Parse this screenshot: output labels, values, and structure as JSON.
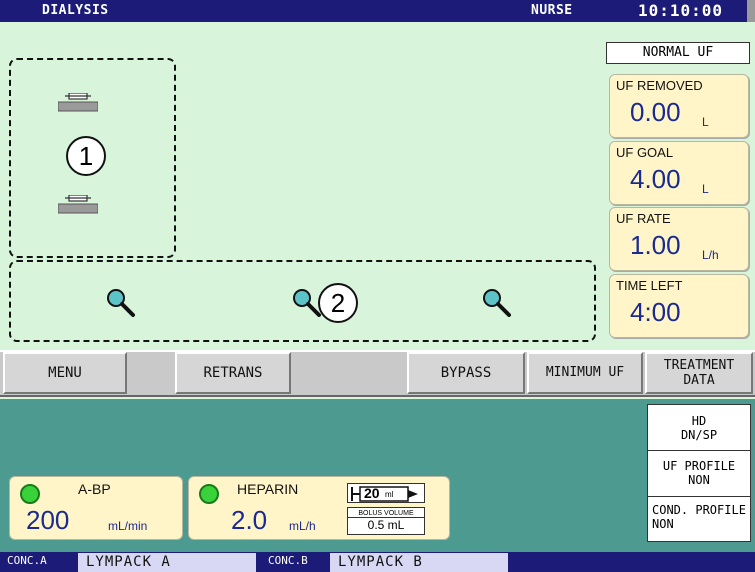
{
  "header": {
    "mode": "DIALYSIS",
    "user": "NURSE",
    "time": "10:10:00"
  },
  "uf": {
    "mode": "NORMAL UF",
    "removed": {
      "label": "UF REMOVED",
      "value": "0.00",
      "unit": "L"
    },
    "goal": {
      "label": "UF GOAL",
      "value": "4.00",
      "unit": "L"
    },
    "rate": {
      "label": "UF RATE",
      "value": "1.00",
      "unit": "L/h"
    },
    "time_left": {
      "label": "TIME LEFT",
      "value": "4:00"
    }
  },
  "callouts": {
    "one": "1",
    "two": "2"
  },
  "menu": {
    "menu": "MENU",
    "retrans": "RETRANS",
    "bypass": "BYPASS",
    "minimum_uf": "MINIMUM UF",
    "treatment_data_line1": "TREATMENT",
    "treatment_data_line2": "DATA"
  },
  "profile": {
    "hd_line1": "HD",
    "hd_line2": "DN/SP",
    "uf_line1": "UF PROFILE",
    "uf_line2": "NON",
    "cond_line1": "COND. PROFILE",
    "cond_line2": "NON"
  },
  "abp": {
    "label": "A-BP",
    "value": "200",
    "unit": "mL/min"
  },
  "heparin": {
    "label": "HEPARIN",
    "value": "2.0",
    "unit": "mL/h",
    "syringe_volume": "20",
    "syringe_unit": "ml",
    "bolus_label": "BOLUS VOLUME",
    "bolus_value": "0.5 mL"
  },
  "concentrate": {
    "a_tag": "CONC.A",
    "a_name": "LYMPACK A",
    "b_tag": "CONC.B",
    "b_name": "LYMPACK B"
  },
  "colors": {
    "bar": "#1c1c78",
    "screen": "#d8f5dc",
    "panel": "#fff5c8",
    "value": "#1a2a90",
    "lower": "#4d9a90",
    "led": "#3ad23a"
  }
}
